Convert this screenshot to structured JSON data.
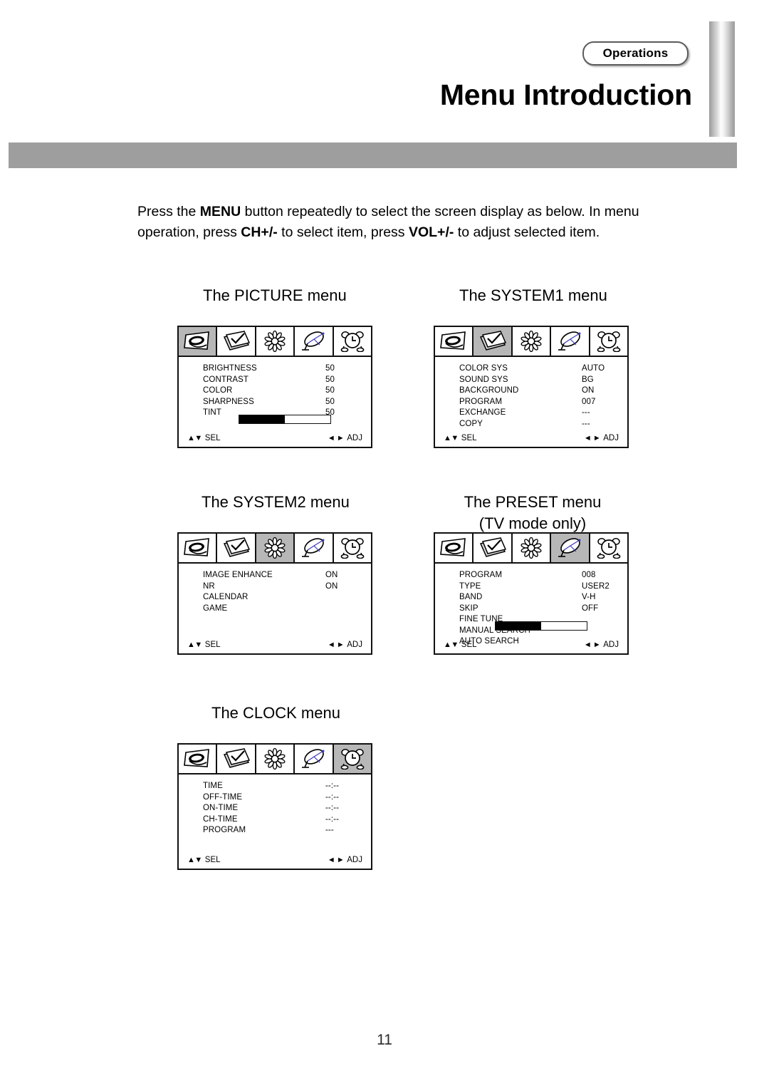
{
  "header": {
    "badge_label": "Operations",
    "title": "Menu Introduction"
  },
  "intro": {
    "part1": "Press the ",
    "menu_key": "MENU",
    "part2": " button repeatedly to select the screen display as below. In menu operation, press ",
    "ch_key": "CH+/-",
    "part3": " to select item, press ",
    "vol_key": "VOL+/-",
    "part4": " to adjust selected item."
  },
  "captions": {
    "picture": "The PICTURE menu",
    "system1": "The SYSTEM1 menu",
    "system2": "The SYSTEM2 menu",
    "preset_line1": "The PRESET menu",
    "preset_line2": "(TV mode only)",
    "clock": "The CLOCK menu"
  },
  "tabs": [
    {
      "name": "picture-tab",
      "icon": "eye-picture-icon"
    },
    {
      "name": "system1-tab",
      "icon": "checkmark-page-icon"
    },
    {
      "name": "system2-tab",
      "icon": "sunburst-flower-icon"
    },
    {
      "name": "preset-tab",
      "icon": "satellite-dish-icon"
    },
    {
      "name": "clock-tab",
      "icon": "alarm-clock-icon"
    }
  ],
  "footer_hints": {
    "select_arrows": "▲▼",
    "select_label": "SEL",
    "adjust_arrows": "◄ ►",
    "adjust_label": "ADJ"
  },
  "menus": {
    "picture": {
      "active_tab": 0,
      "rows": [
        {
          "label": "BRIGHTNESS",
          "value": "50"
        },
        {
          "label": "CONTRAST",
          "value": "50"
        },
        {
          "label": "COLOR",
          "value": "50"
        },
        {
          "label": "SHARPNESS",
          "value": "50"
        },
        {
          "label": "TINT",
          "value": "50"
        }
      ],
      "progress": 50,
      "has_progress": true
    },
    "system1": {
      "active_tab": 1,
      "rows": [
        {
          "label": "COLOR SYS",
          "value": "AUTO"
        },
        {
          "label": "SOUND SYS",
          "value": "BG"
        },
        {
          "label": "BACKGROUND",
          "value": "ON"
        },
        {
          "label": "PROGRAM",
          "value": "007"
        },
        {
          "label": "EXCHANGE",
          "value": "---"
        },
        {
          "label": "COPY",
          "value": "---"
        }
      ],
      "has_progress": false
    },
    "system2": {
      "active_tab": 2,
      "rows": [
        {
          "label": "IMAGE ENHANCE",
          "value": "ON"
        },
        {
          "label": "NR",
          "value": "ON"
        },
        {
          "label": "CALENDAR",
          "value": ""
        },
        {
          "label": "GAME",
          "value": ""
        }
      ],
      "has_progress": false
    },
    "preset": {
      "active_tab": 3,
      "rows": [
        {
          "label": "PROGRAM",
          "value": "008"
        },
        {
          "label": "TYPE",
          "value": "USER2"
        },
        {
          "label": "BAND",
          "value": "V-H"
        },
        {
          "label": "SKIP",
          "value": "OFF"
        },
        {
          "label": "FINE TUNE",
          "value": ""
        },
        {
          "label": "MANUAL SEARCH",
          "value": ""
        },
        {
          "label": "AUTO SEARCH",
          "value": ""
        }
      ],
      "progress": 50,
      "has_progress": true
    },
    "clock": {
      "active_tab": 4,
      "rows": [
        {
          "label": "TIME",
          "value": "--:--"
        },
        {
          "label": "OFF-TIME",
          "value": "--:--"
        },
        {
          "label": "ON-TIME",
          "value": "--:--"
        },
        {
          "label": "CH-TIME",
          "value": "--:--"
        },
        {
          "label": "PROGRAM",
          "value": "---"
        }
      ],
      "has_progress": false
    }
  },
  "page_number": "11"
}
